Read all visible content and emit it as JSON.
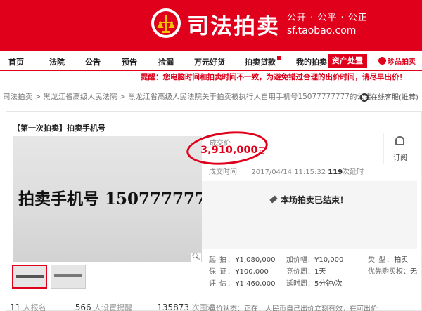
{
  "header": {
    "brand": "司法拍卖",
    "slogan": "公开 · 公平 · 公正",
    "domain": "sf.taobao.com"
  },
  "nav": {
    "items": [
      "首页",
      "法院",
      "公告",
      "预告",
      "捡漏",
      "万元好货",
      "拍卖贷款",
      "我的拍卖"
    ],
    "hot_label": "资产处置",
    "brand_label": "珍品拍卖"
  },
  "warning": "提醒：您电脑时间和拍卖时间不一致，为避免错过合理的出价时间，请尽早出价！",
  "breadcrumb": "司法拍卖 > 黑龙江省高级人民法院 > 黑龙江省高级人民法院关于拍卖被执行人自用手机号15077777777的公告",
  "service_label": "在线客服(推荐)",
  "item": {
    "title": "【第一次拍卖】拍卖手机号",
    "photo_text": "拍卖手机号 1507777777"
  },
  "deal": {
    "label": "成交价",
    "price": "3,910,000",
    "currency": "元",
    "time_label": "成交时间",
    "time": "2017/04/14 11:15:32",
    "bids": "119",
    "bids_label": "次延时"
  },
  "subscribe_label": "订阅",
  "ended_text": "本场拍卖已结束！",
  "info": {
    "col1": [
      {
        "k": "起 拍：",
        "v": "¥1,080,000"
      },
      {
        "k": "保 证：",
        "v": "¥100,000"
      },
      {
        "k": "评 估：",
        "v": "¥1,460,000"
      }
    ],
    "col2": [
      {
        "k": "加价幅：",
        "v": "¥10,000"
      },
      {
        "k": "竞价周：",
        "v": "1天"
      },
      {
        "k": "延时周：",
        "v": "5分钟/次"
      }
    ],
    "col3": [
      {
        "k": "类 型：",
        "v": "拍卖"
      },
      {
        "k": "优先购买权：",
        "v": "无"
      }
    ]
  },
  "stats": {
    "signup_count": "11",
    "signup_label": "人报名",
    "reminder_count": "566",
    "reminder_label": "人设置提醒",
    "views_count": "135873",
    "views_label": "次围观"
  },
  "bottom_text": "竞价状态：正在，人民币自己出价立刻有效，在可出价"
}
